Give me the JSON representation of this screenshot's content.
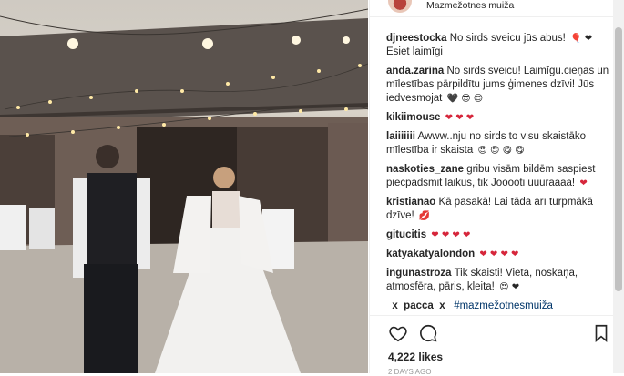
{
  "post": {
    "location": "Mazmežotnes muiža",
    "likes": "4,222 likes",
    "timestamp": "2 DAYS AGO"
  },
  "comments": [
    {
      "user": "djneestocka",
      "text": "No sirds sveicu jūs abus!",
      "tail": "Esiet laimīgi",
      "emoji": "🎈 ❤"
    },
    {
      "user": "anda.zarina",
      "text": "No sirds sveicu! Laimīgu.cieņas un mīlestības pārpildītu jums ģimenes dzīvi! Jūs iedvesmojat",
      "emoji": "🖤 😎 😍"
    },
    {
      "user": "kikiimouse",
      "text": "",
      "emoji": "❤ ❤ ❤"
    },
    {
      "user": "laiiiiiii",
      "text": "Awww..nju no sirds to visu skaistāko mīlestība ir skaista",
      "emoji": "😍 😍 😋 😋"
    },
    {
      "user": "naskoties_zane",
      "text": "gribu visām bildēm saspiest piecpadsmit laikus, tik Jooooti uuuraaaa!",
      "emoji": "❤"
    },
    {
      "user": "kristianao",
      "text": "Kā pasakā! Lai tāda arī turpmākā dzīve!",
      "emoji": "💋"
    },
    {
      "user": "gitucitis",
      "text": "",
      "emoji": "❤ ❤ ❤ ❤"
    },
    {
      "user": "katyakatyalondon",
      "text": "",
      "emoji": "❤ ❤ ❤ ❤"
    },
    {
      "user": "ingunastroza",
      "text": "Tik skaisti! Vieta, noskaņa, atmosfēra, pāris, kleita!",
      "emoji": "😍 ❤"
    },
    {
      "user": "_x_pacca_x_",
      "text": "#mazmežotnesmuiža",
      "emoji": ""
    }
  ],
  "icons": [
    "heart-icon",
    "comment-icon",
    "bookmark-icon"
  ]
}
